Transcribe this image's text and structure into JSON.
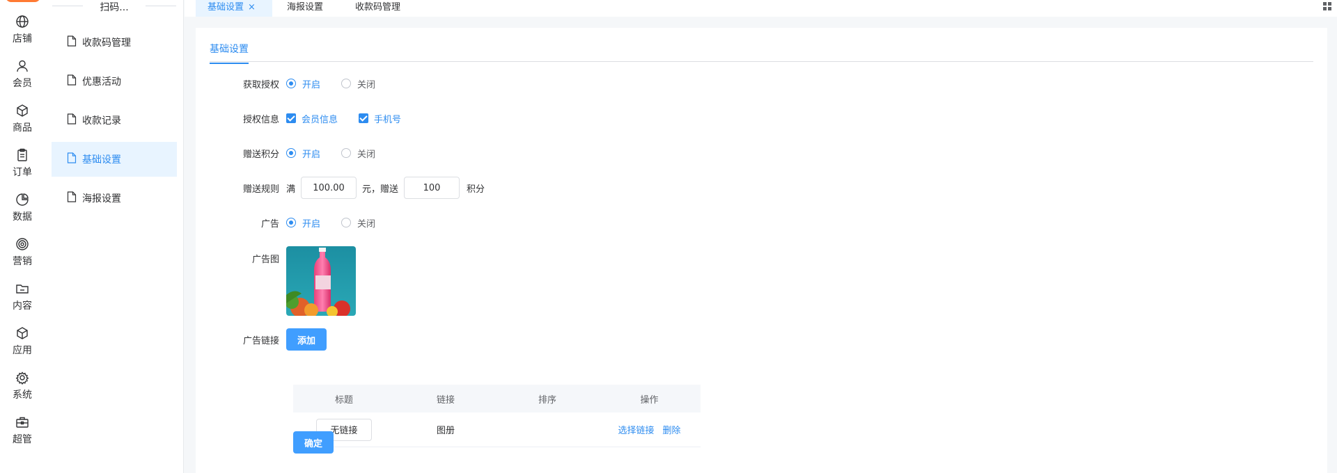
{
  "sidebar": {
    "items": [
      {
        "label": "店铺",
        "icon": "globe-icon"
      },
      {
        "label": "会员",
        "icon": "user-icon"
      },
      {
        "label": "商品",
        "icon": "box-icon"
      },
      {
        "label": "订单",
        "icon": "clipboard-icon"
      },
      {
        "label": "数据",
        "icon": "pie-chart-icon"
      },
      {
        "label": "营销",
        "icon": "target-icon"
      },
      {
        "label": "内容",
        "icon": "folder-icon"
      },
      {
        "label": "应用",
        "icon": "cube-icon"
      },
      {
        "label": "系统",
        "icon": "gear-icon"
      },
      {
        "label": "超管",
        "icon": "toolbox-icon"
      }
    ]
  },
  "submenu": {
    "title": "扫码...",
    "items": [
      {
        "label": "收款码管理"
      },
      {
        "label": "优惠活动"
      },
      {
        "label": "收款记录"
      },
      {
        "label": "基础设置",
        "active": true
      },
      {
        "label": "海报设置"
      }
    ]
  },
  "tabs": [
    {
      "label": "基础设置",
      "active": true,
      "close": "×"
    },
    {
      "label": "海报设置"
    },
    {
      "label": "收款码管理"
    }
  ],
  "page": {
    "inner_tab": "基础设置",
    "auth": {
      "label": "获取授权",
      "on": "开启",
      "off": "关闭",
      "value": "on"
    },
    "auth_info": {
      "label": "授权信息",
      "options": [
        "会员信息",
        "手机号"
      ]
    },
    "points": {
      "label": "赠送积分",
      "on": "开启",
      "off": "关闭",
      "value": "on"
    },
    "rule": {
      "label": "赠送规则",
      "prefix": "满",
      "amount": "100.00",
      "mid": "元，赠送",
      "points": "100",
      "suffix": "积分"
    },
    "ad": {
      "label": "广告",
      "on": "开启",
      "off": "关闭",
      "value": "on"
    },
    "ad_image": {
      "label": "广告图"
    },
    "ad_link": {
      "label": "广告链接",
      "add_button": "添加"
    },
    "table": {
      "headers": [
        "标题",
        "链接",
        "排序",
        "操作"
      ],
      "rows": [
        {
          "title": "无链接",
          "link": "图册",
          "sort": "",
          "actions": [
            "选择链接",
            "删除"
          ]
        }
      ]
    },
    "confirm_button": "确定"
  },
  "colors": {
    "accent": "#2d8cf0",
    "button": "#409eff",
    "brand": "#ff7a33"
  }
}
